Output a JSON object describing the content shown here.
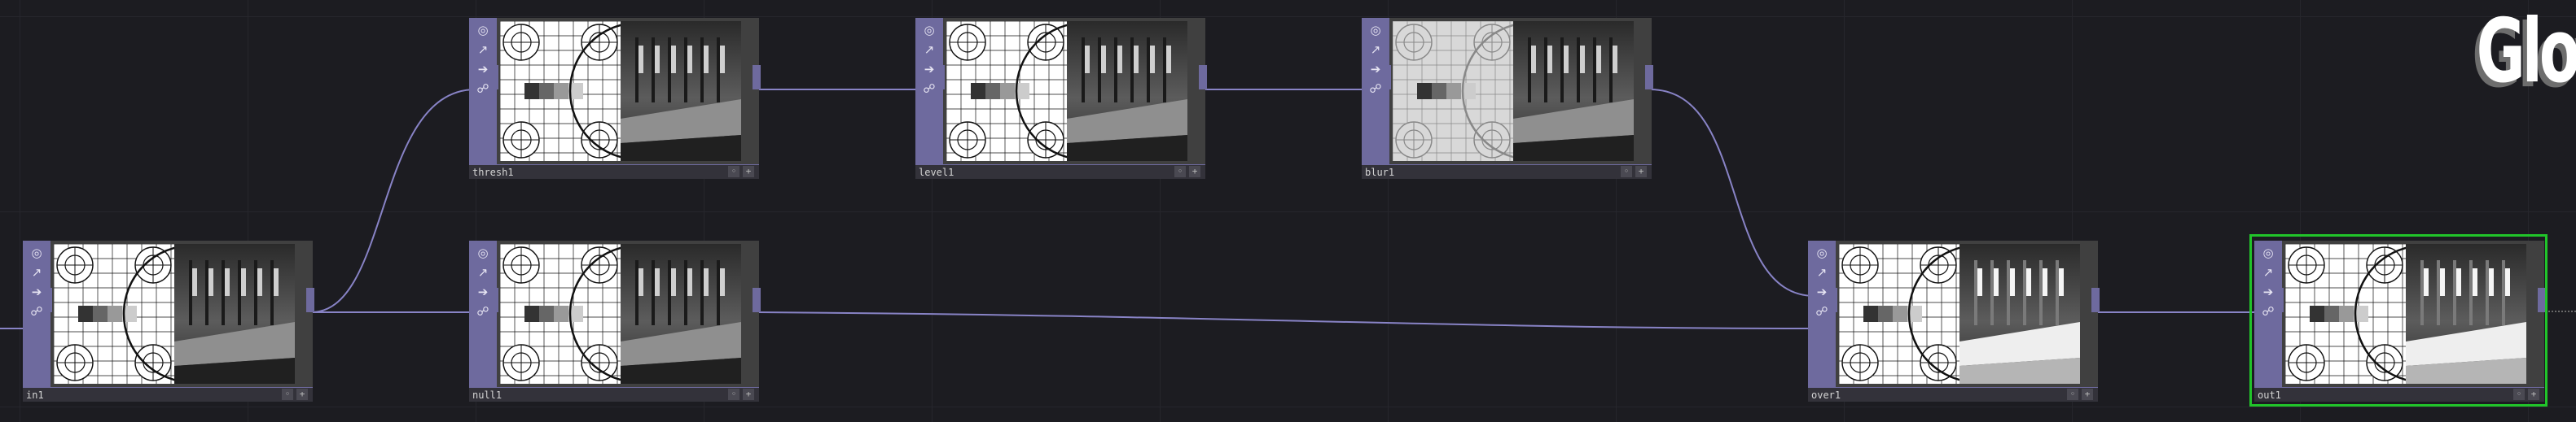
{
  "network": {
    "title": "Glow",
    "accent_color": "#6e6a9e",
    "wire_color": "#8883c6",
    "selection_color": "#21c42a",
    "nodes": [
      {
        "id": "in1",
        "label": "in1",
        "variant": "normal"
      },
      {
        "id": "thresh1",
        "label": "thresh1",
        "variant": "normal"
      },
      {
        "id": "level1",
        "label": "level1",
        "variant": "normal"
      },
      {
        "id": "blur1",
        "label": "blur1",
        "variant": "blur"
      },
      {
        "id": "null1",
        "label": "null1",
        "variant": "normal"
      },
      {
        "id": "over1",
        "label": "over1",
        "variant": "bright"
      },
      {
        "id": "out1",
        "label": "out1",
        "variant": "bright",
        "selected": true
      }
    ],
    "node_flags": [
      "viewer-flag-icon",
      "bypass-flag-icon",
      "cook-flag-icon",
      "lock-flag-icon"
    ],
    "label_buttons": [
      "viewer-toggle-icon",
      "add-icon"
    ]
  }
}
